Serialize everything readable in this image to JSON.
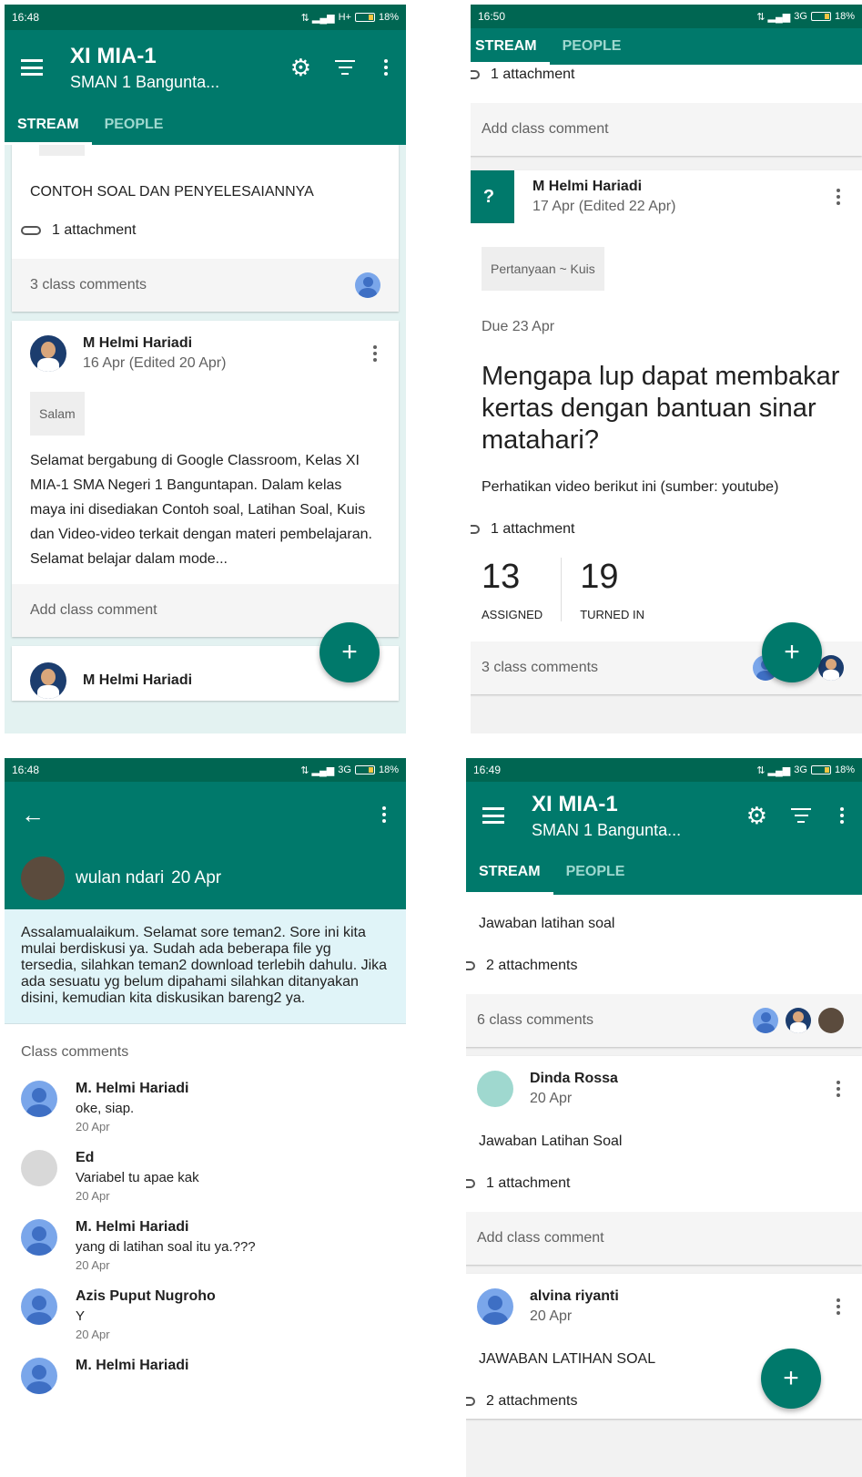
{
  "p1": {
    "status": {
      "time": "16:48",
      "signal": "H+",
      "battery": "18%"
    },
    "app": {
      "title": "XI MIA-1",
      "subtitle": "SMAN 1 Bangunta..."
    },
    "tabs": [
      "STREAM",
      "PEOPLE"
    ],
    "card1": {
      "title": "CONTOH SOAL DAN PENYELESAIANNYA",
      "attachment": "1 attachment",
      "comments": "3 class comments"
    },
    "card2": {
      "author": "M Helmi Hariadi",
      "date": "16 Apr (Edited 20 Apr)",
      "chip": "Salam",
      "text": "Selamat bergabung di Google Classroom, Kelas XI MIA-1 SMA Negeri 1 Banguntapan. Dalam kelas maya ini disediakan Contoh soal, Latihan Soal, Kuis dan Video-video terkait dengan materi pembelajaran. Selamat belajar dalam mode...",
      "add_comment": "Add class comment"
    },
    "card3": {
      "author": "M Helmi Hariadi"
    },
    "fab": "+"
  },
  "p2": {
    "status": {
      "time": "16:50",
      "signal": "3G",
      "battery": "18%"
    },
    "tabs": [
      "STREAM",
      "PEOPLE"
    ],
    "prev_attachment": "1 attachment",
    "prev_add_comment": "Add class comment",
    "card": {
      "icon": "?",
      "author": "M Helmi Hariadi",
      "date": "17 Apr (Edited 22 Apr)",
      "chip": "Pertanyaan ~ Kuis",
      "due": "Due 23 Apr",
      "question": "Mengapa lup dapat membakar kertas dengan bantuan sinar matahari?",
      "instruction": "Perhatikan video berikut ini (sumber: youtube)",
      "attachment": "1 attachment",
      "assigned_num": "13",
      "assigned_label": "ASSIGNED",
      "turned_num": "19",
      "turned_label": "TURNED IN",
      "comments": "3 class comments"
    },
    "fab": "+"
  },
  "p3": {
    "status": {
      "time": "16:48",
      "signal": "3G",
      "battery": "18%"
    },
    "back": "←",
    "post": {
      "author": "wulan ndari",
      "date": "20 Apr",
      "text": "Assalamualaikum. Selamat sore teman2. Sore ini kita mulai berdiskusi ya. Sudah ada beberapa file yg tersedia, silahkan teman2 download terlebih dahulu. Jika ada sesuatu yg belum dipahami silahkan ditanyakan disini, kemudian kita diskusikan bareng2 ya."
    },
    "comments_label": "Class comments",
    "comments": [
      {
        "name": "M. Helmi Hariadi",
        "text": "oke, siap.",
        "date": "20 Apr"
      },
      {
        "name": "Ed",
        "text": "Variabel tu apae kak",
        "date": "20 Apr"
      },
      {
        "name": "M. Helmi Hariadi",
        "text": "yang di latihan soal itu ya.???",
        "date": "20 Apr"
      },
      {
        "name": "Azis Puput Nugroho",
        "text": "Y",
        "date": "20 Apr"
      },
      {
        "name": "M. Helmi Hariadi"
      }
    ]
  },
  "p4": {
    "status": {
      "time": "16:49",
      "signal": "3G",
      "battery": "18%"
    },
    "app": {
      "title": "XI MIA-1",
      "subtitle": "SMAN 1 Bangunta..."
    },
    "tabs": [
      "STREAM",
      "PEOPLE"
    ],
    "card1": {
      "title": "Jawaban latihan soal",
      "attachment": "2 attachments",
      "comments": "6 class comments"
    },
    "card2": {
      "author": "Dinda Rossa",
      "date": "20 Apr",
      "title": "Jawaban Latihan Soal",
      "attachment": "1 attachment",
      "add_comment": "Add class comment"
    },
    "card3": {
      "author": "alvina riyanti",
      "date": "20 Apr",
      "title": "JAWABAN LATIHAN SOAL",
      "attachment": "2 attachments"
    },
    "fab": "+"
  }
}
